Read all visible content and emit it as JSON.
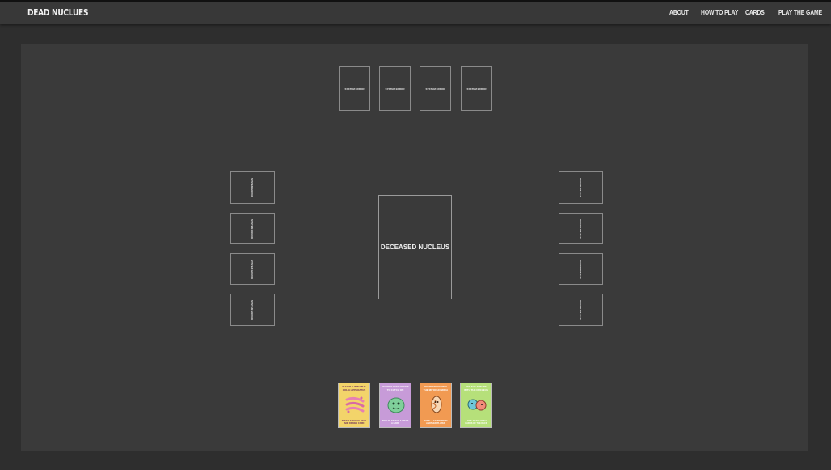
{
  "header": {
    "brand": "DEAD NUCLUES",
    "nav": [
      {
        "label": "ABOUT"
      },
      {
        "label": "HOW TO PLAY"
      },
      {
        "label": "CARDS"
      },
      {
        "label": "PLAY THE GAME"
      }
    ]
  },
  "board": {
    "deck_label": "DECEASED NUCLEUS",
    "opponent_top": [
      "SYSTEM ERROR",
      "SYSTEM ERROR",
      "SYSTEM ERROR",
      "SYSTEM ERROR"
    ],
    "opponent_left": [
      "SYSTEM ERROR",
      "SYSTEM ERROR",
      "SYSTEM ERROR",
      "SYSTEM ERROR"
    ],
    "opponent_right": [
      "SYSTEM ERROR",
      "SYSTEM ERROR",
      "SYSTEM ERROR",
      "SYSTEM ERROR"
    ]
  },
  "hand": [
    {
      "title": "SHUFFLE WITH THE GOLGI APPARATUS",
      "text": "SHUFFLE WHOLE DECK AND DRAW 1 CARD",
      "color": "#f3d46a",
      "art": "golgi-art-icon"
    },
    {
      "title": "NOBODY EVER SEEMS TO CATCH ON",
      "text": "SKIP AN ATTACK & DRAW A CARD",
      "color": "#c79bd8",
      "art": "ribosome-art-icon"
    },
    {
      "title": "OVERPOWER WITH THE MITOCHONDRIA",
      "text": "STEAL 2 CARDS FROM ANOTHER PLAYER",
      "color": "#f19a52",
      "art": "mitochondria-art-icon"
    },
    {
      "title": "SEE THE FUTURE WITH THE NUCLEUS",
      "text": "LOOK AT THE TOP 3 CARDS OF THE DECK",
      "color": "#b6e07a",
      "art": "nucleus-art-icon"
    }
  ]
}
